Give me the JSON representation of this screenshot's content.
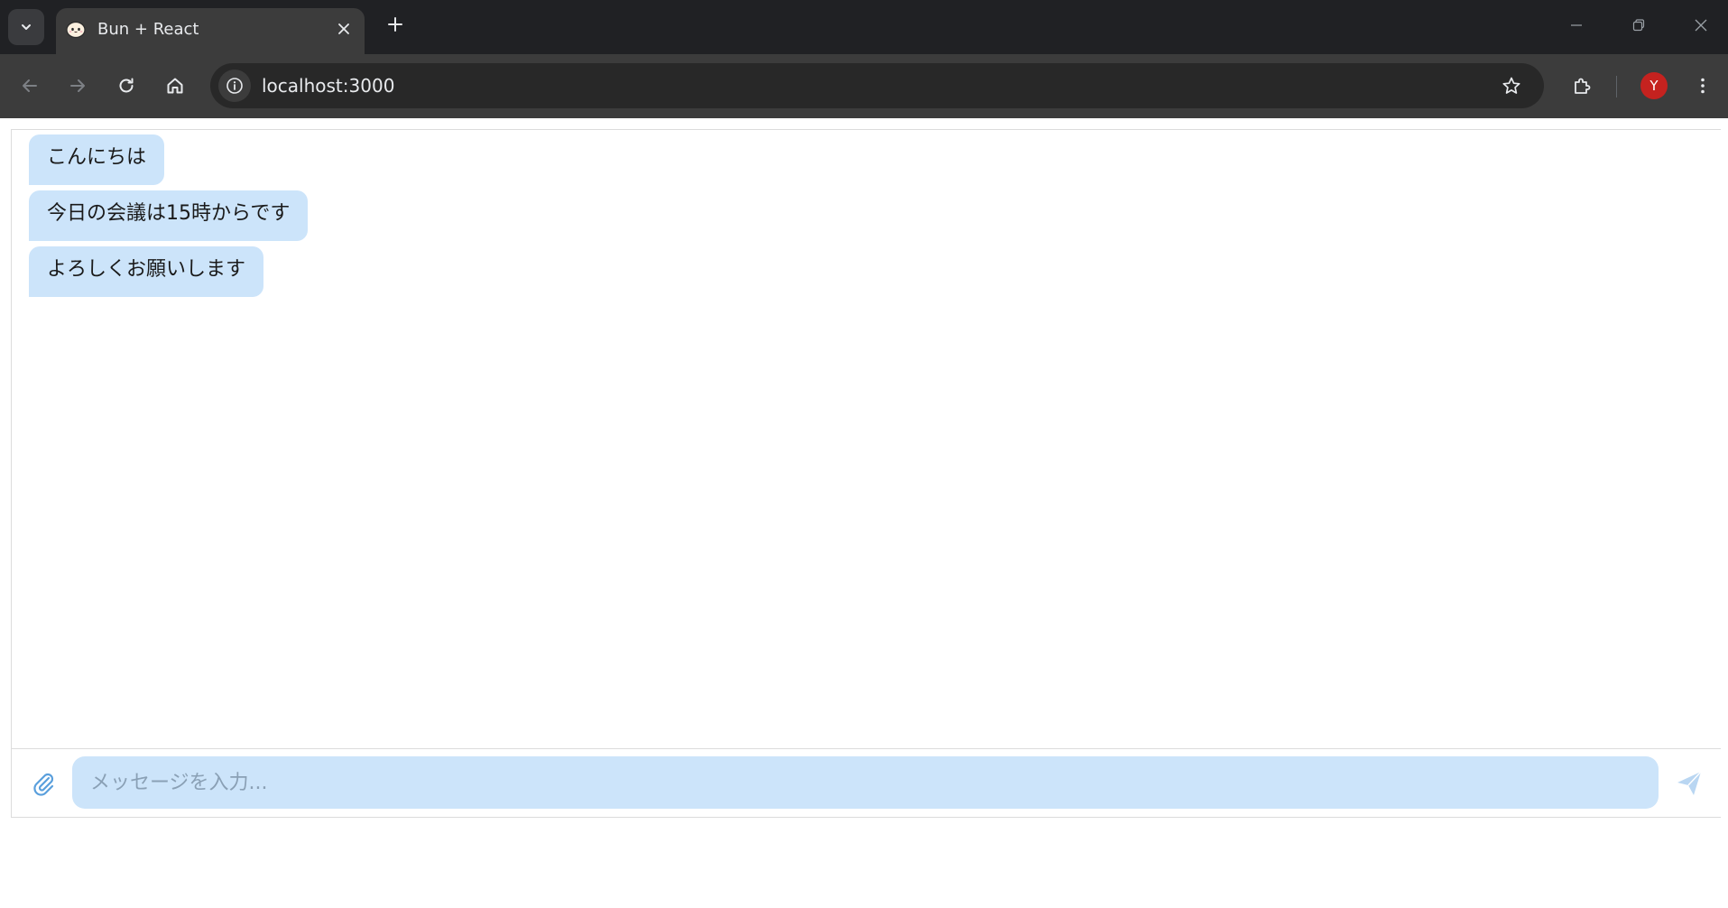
{
  "browser": {
    "tab": {
      "title": "Bun + React",
      "favicon": "bun-logo-icon"
    },
    "address": {
      "url": "localhost:3000"
    },
    "profile": {
      "initial": "Y",
      "color": "#c5221f"
    }
  },
  "chat": {
    "messages": [
      {
        "text": "こんにちは"
      },
      {
        "text": "今日の会議は15時からです"
      },
      {
        "text": "よろしくお願いします"
      }
    ],
    "input": {
      "placeholder": "メッセージを入力...",
      "value": ""
    },
    "bubble_color": "#cce4fa",
    "accent_color": "#5a9fdc"
  }
}
